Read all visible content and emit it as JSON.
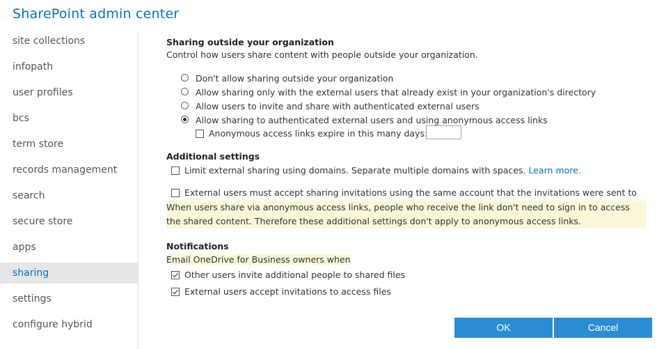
{
  "app": {
    "title": "SharePoint admin center"
  },
  "sidebar": {
    "items": [
      {
        "label": "site collections"
      },
      {
        "label": "infopath"
      },
      {
        "label": "user profiles"
      },
      {
        "label": "bcs"
      },
      {
        "label": "term store"
      },
      {
        "label": "records management"
      },
      {
        "label": "search"
      },
      {
        "label": "secure store"
      },
      {
        "label": "apps"
      },
      {
        "label": "sharing",
        "active": true
      },
      {
        "label": "settings"
      },
      {
        "label": "configure hybrid"
      }
    ]
  },
  "sharing_outside": {
    "title": "Sharing outside your organization",
    "description": "Control how users share content with people outside your organization.",
    "options": [
      {
        "label": "Don't allow sharing outside your organization",
        "selected": false
      },
      {
        "label": "Allow sharing only with the external users that already exist in your organization's directory",
        "selected": false
      },
      {
        "label": "Allow users to invite and share with authenticated external users",
        "selected": false
      },
      {
        "label": "Allow sharing to authenticated external users and using anonymous access links",
        "selected": true
      }
    ],
    "expire_label": "Anonymous access links expire in this many days:",
    "expire_checked": false,
    "expire_days": ""
  },
  "additional": {
    "title": "Additional settings",
    "limit_domains_label": "Limit external sharing using domains. Separate multiple domains with spaces.",
    "limit_domains_checked": false,
    "learn_more": "Learn more.",
    "accept_same_account_label": "External users must accept sharing invitations using the same account that the invitations were sent to",
    "accept_same_account_checked": false,
    "note": "When users share via anonymous access links, people who receive the link don't need to sign in to access the shared content. Therefore these additional settings don't apply to anonymous access links."
  },
  "notifications": {
    "title": "Notifications",
    "subtitle": "Email OneDrive for Business owners when",
    "items": [
      {
        "label": "Other users invite additional people to shared files",
        "checked": true
      },
      {
        "label": "External users accept invitations to access files",
        "checked": true
      }
    ]
  },
  "buttons": {
    "ok": "OK",
    "cancel": "Cancel"
  },
  "colors": {
    "accent": "#0072c6",
    "button": "#2a8dd4",
    "highlight": "#fbf7d9",
    "active_nav_bg": "#e6e6e6"
  }
}
